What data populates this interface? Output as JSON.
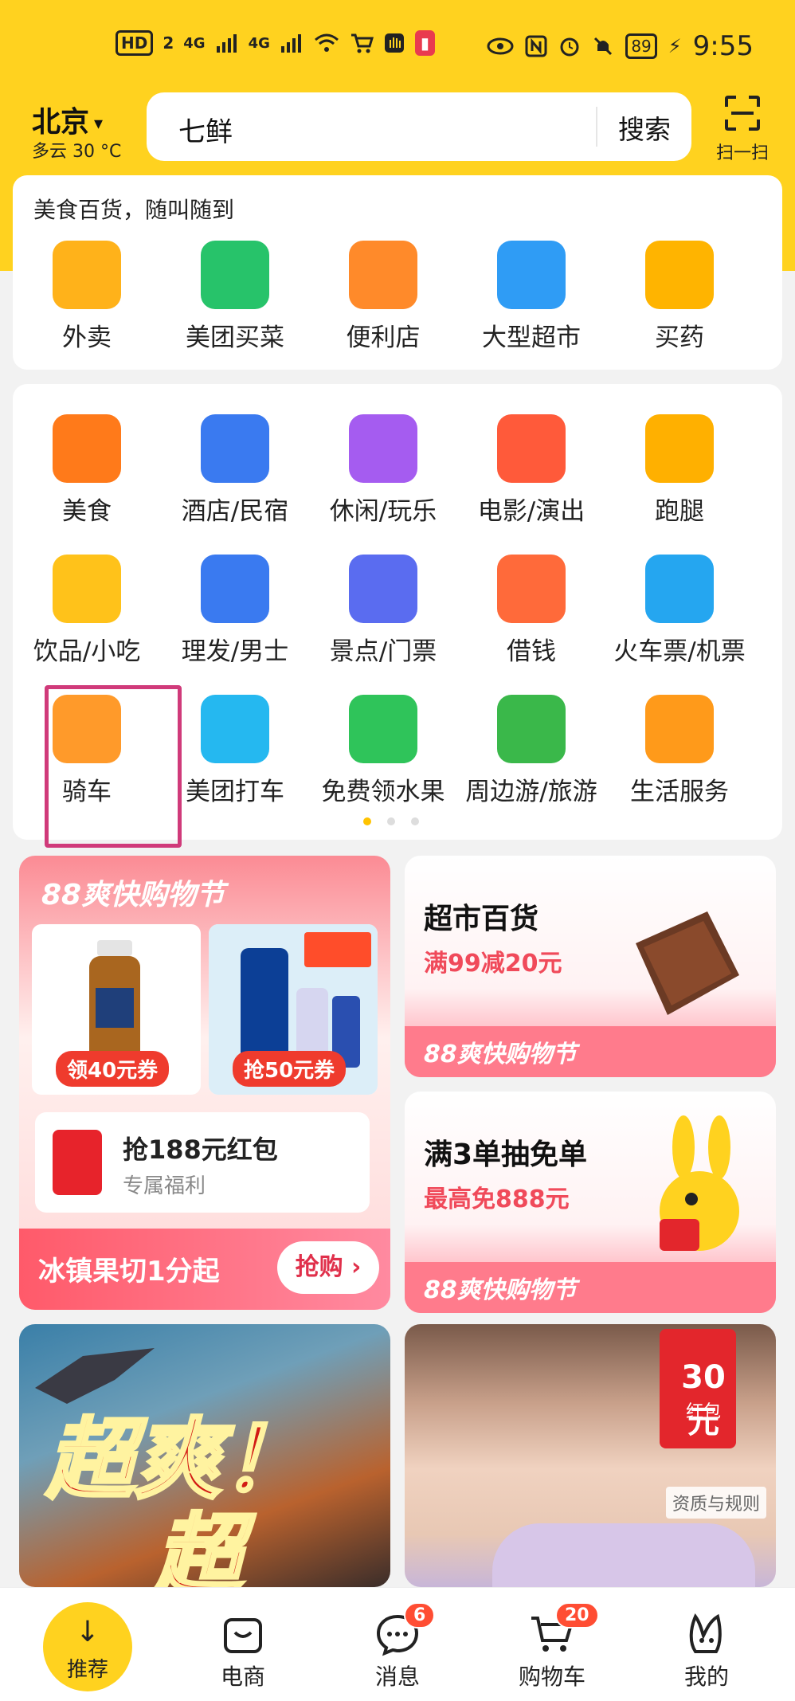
{
  "status_bar": {
    "left_items": [
      "HD",
      "2",
      "4G",
      "4G"
    ],
    "battery": "89",
    "time": "9:55"
  },
  "header": {
    "city": "北京",
    "weather": "多云 30 °C",
    "search_text": "七鲜",
    "search_button": "搜索",
    "scan_label": "扫一扫"
  },
  "card1": {
    "subtitle": "美食百货，随叫随到",
    "items": [
      {
        "label": "外卖",
        "icon": "takeaway-rabbit-icon",
        "color": "#ffb21a"
      },
      {
        "label": "美团买菜",
        "icon": "vegetable-basket-icon",
        "color": "#27c36a"
      },
      {
        "label": "便利店",
        "icon": "convenience-store-icon",
        "color": "#ff8a2a"
      },
      {
        "label": "大型超市",
        "icon": "supermarket-cart-icon",
        "color": "#2f9cf5"
      },
      {
        "label": "买药",
        "icon": "medicine-kit-icon",
        "color": "#ffb400"
      }
    ]
  },
  "card2": {
    "rows": [
      [
        {
          "label": "美食",
          "icon": "fork-knife-icon",
          "color": "#ff7a1a"
        },
        {
          "label": "酒店/民宿",
          "icon": "hotel-building-icon",
          "color": "#3a7af0"
        },
        {
          "label": "休闲/玩乐",
          "icon": "leisure-grid-icon",
          "color": "#a55cf0"
        },
        {
          "label": "电影/演出",
          "icon": "movie-cat-icon",
          "color": "#ff5a3a"
        },
        {
          "label": "跑腿",
          "icon": "errand-runner-icon",
          "color": "#ffb000"
        }
      ],
      [
        {
          "label": "饮品/小吃",
          "icon": "drink-donut-icon",
          "color": "#ffc21a"
        },
        {
          "label": "理发/男士",
          "icon": "barber-head-icon",
          "color": "#3a7af0"
        },
        {
          "label": "景点/门票",
          "icon": "temple-icon",
          "color": "#5a6cf0"
        },
        {
          "label": "借钱",
          "icon": "yuan-loan-icon",
          "color": "#ff6a3a"
        },
        {
          "label": "火车票/机票",
          "icon": "train-plane-icon",
          "color": "#25a6f0"
        }
      ],
      [
        {
          "label": "骑车",
          "icon": "bicycle-icon",
          "color": "#ff9a2a"
        },
        {
          "label": "美团打车",
          "icon": "taxi-car-icon",
          "color": "#25b8f0"
        },
        {
          "label": "免费领水果",
          "icon": "fruit-tree-icon",
          "color": "#2fc45a"
        },
        {
          "label": "周边游/旅游",
          "icon": "palm-tree-icon",
          "color": "#3ab84a"
        },
        {
          "label": "生活服务",
          "icon": "tools-broom-icon",
          "color": "#ff9a1a"
        }
      ]
    ]
  },
  "promo_left": {
    "title": "88爽快购物节",
    "product1_badge": "领40元券",
    "product2_badge": "抢50元券",
    "redpack_title": "抢188元红包",
    "redpack_sub": "专属福利",
    "bottom_text": "冰镇果切1分起",
    "bottom_button": "抢购 ›"
  },
  "promo_right_1": {
    "title": "超市百货",
    "subtitle": "满99减20元",
    "footer": "88爽快购物节"
  },
  "promo_right_2": {
    "title": "满3单抽免单",
    "subtitle": "最高免888元",
    "footer": "88爽快购物节"
  },
  "feed": {
    "left_line1": "超爽！",
    "left_line2": "超燃！",
    "right_amount": "30元",
    "right_label": "红包",
    "right_rule": "资质与规则"
  },
  "bottom_nav": [
    {
      "label": "推荐",
      "icon": "down-arrow-icon"
    },
    {
      "label": "电商",
      "icon": "shop-bag-icon"
    },
    {
      "label": "消息",
      "icon": "message-bubble-icon",
      "badge": "6"
    },
    {
      "label": "购物车",
      "icon": "cart-icon",
      "badge": "20"
    },
    {
      "label": "我的",
      "icon": "profile-rabbit-icon"
    }
  ],
  "colors": {
    "brand_yellow": "#ffd21f",
    "highlight_border": "#d03a7a",
    "promo_red": "#ef3b2d"
  }
}
